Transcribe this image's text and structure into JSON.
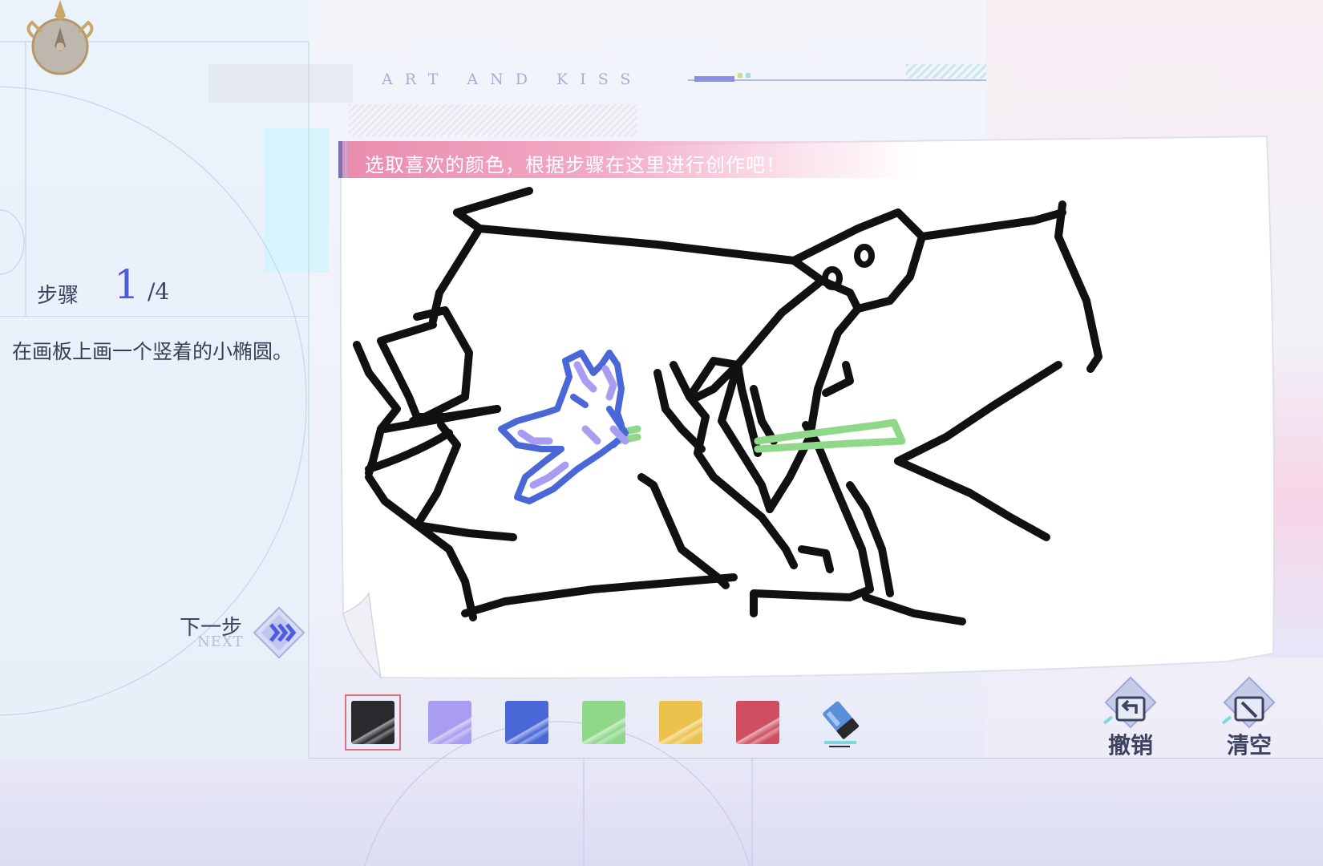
{
  "header": {
    "title": "ART AND KISS"
  },
  "step": {
    "label": "步骤",
    "current": "1",
    "total": "/4",
    "description": "在画板上画一个竖着的小椭圆。"
  },
  "next_button": {
    "label": "下一步",
    "sub_label": "NEXT"
  },
  "canvas": {
    "prompt": "选取喜欢的颜色，根据步骤在这里进行创作吧！"
  },
  "palette": {
    "selected_index": 0,
    "colors": [
      {
        "name": "black",
        "hex": "#2a2a2e"
      },
      {
        "name": "lavender",
        "hex": "#a89df0"
      },
      {
        "name": "blue",
        "hex": "#4a67d8"
      },
      {
        "name": "green",
        "hex": "#8fd88a"
      },
      {
        "name": "yellow",
        "hex": "#ecc24c"
      },
      {
        "name": "red",
        "hex": "#cf4f60"
      }
    ],
    "eraser_icon": "eraser-icon"
  },
  "tools": {
    "undo_label": "撤销",
    "clear_label": "清空",
    "undo_icon": "undo-icon",
    "clear_icon": "clear-icon"
  },
  "colors": {
    "accent": "#4f5be0",
    "banner": "#e98cae",
    "stroke_black": "#111111",
    "stroke_blue": "#4a67d8",
    "stroke_lavender": "#a89df0",
    "stroke_green": "#8fd88a"
  }
}
